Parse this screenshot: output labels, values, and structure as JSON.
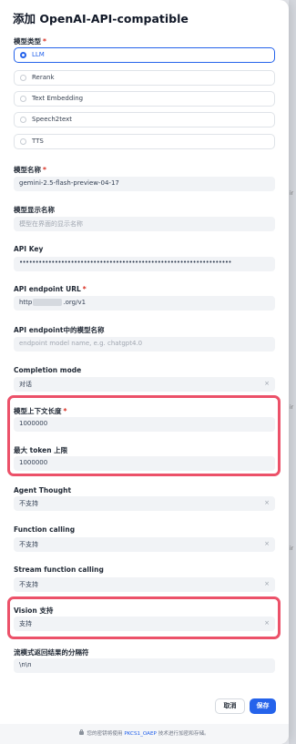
{
  "dialog": {
    "title": "添加 OpenAI-API-compatible"
  },
  "model_type": {
    "label": "模型类型",
    "required_mark": "*",
    "options": [
      "LLM",
      "Rerank",
      "Text Embedding",
      "Speech2text",
      "TTS"
    ],
    "selected": "LLM"
  },
  "model_name": {
    "label": "模型名称",
    "required_mark": "*",
    "value": "gemini-2.5-flash-preview-04-17"
  },
  "display_name": {
    "label": "模型显示名称",
    "placeholder": "模型在界面的显示名称"
  },
  "api_key": {
    "label": "API Key",
    "value": "••••••••••••••••••••••••••••••••••••••••••••••••••••••••••••••••••"
  },
  "endpoint_url": {
    "label": "API endpoint URL",
    "required_mark": "*",
    "value_prefix": "http",
    "value_suffix": ".org/v1"
  },
  "endpoint_model_name": {
    "label": "API endpoint中的模型名称",
    "placeholder": "endpoint model name, e.g. chatgpt4.0"
  },
  "completion_mode": {
    "label": "Completion mode",
    "value": "对话"
  },
  "context_length": {
    "label": "模型上下文长度",
    "required_mark": "*",
    "value": "1000000"
  },
  "max_tokens": {
    "label": "最大 token 上限",
    "value": "1000000"
  },
  "agent_thought": {
    "label": "Agent Thought",
    "value": "不支持"
  },
  "function_calling": {
    "label": "Function calling",
    "value": "不支持"
  },
  "stream_function_calling": {
    "label": "Stream function calling",
    "value": "不支持"
  },
  "vision": {
    "label": "Vision 支持",
    "value": "支持"
  },
  "stream_delimiter": {
    "label": "流模式返回结果的分隔符",
    "value": "\\n\\n"
  },
  "buttons": {
    "cancel": "取消",
    "save": "保存"
  },
  "footer": {
    "prefix": "您的密钥将使用",
    "link": "PKCS1_OAEP",
    "suffix": "技术进行加密和存储。"
  },
  "icons": {
    "clear": "×"
  },
  "colors": {
    "accent": "#2563eb",
    "highlight": "#ec5169"
  }
}
